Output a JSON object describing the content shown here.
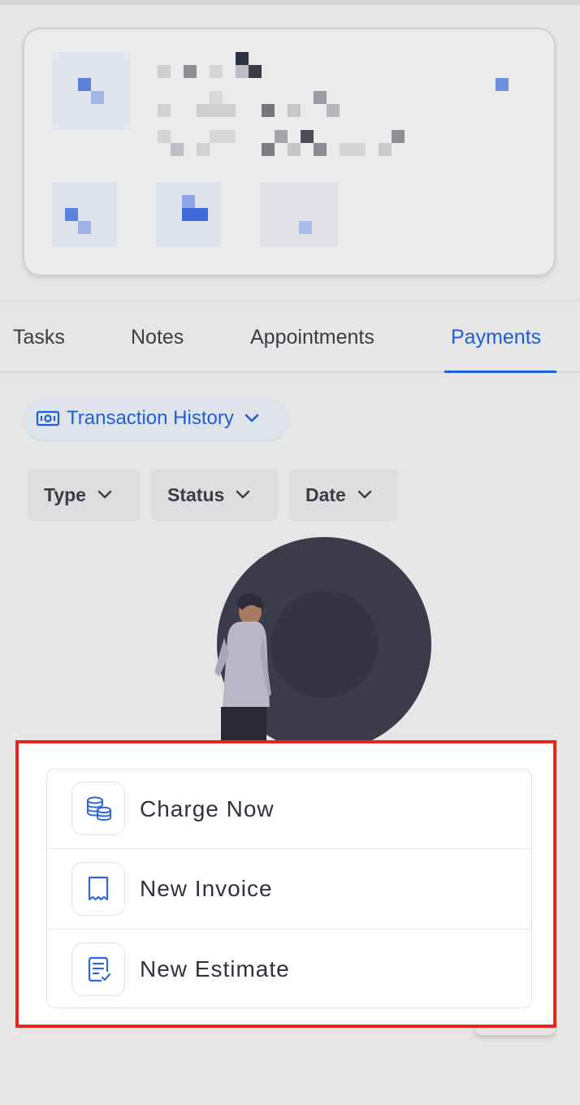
{
  "tabs": [
    {
      "label": "Tasks"
    },
    {
      "label": "Notes"
    },
    {
      "label": "Appointments"
    },
    {
      "label": "Payments",
      "active": true
    }
  ],
  "history_dropdown": {
    "label": "Transaction History"
  },
  "filters": [
    {
      "label": "Type"
    },
    {
      "label": "Status"
    },
    {
      "label": "Date"
    }
  ],
  "actions": [
    {
      "label": "Charge Now",
      "icon": "coins-icon"
    },
    {
      "label": "New Invoice",
      "icon": "receipt-icon"
    },
    {
      "label": "New Estimate",
      "icon": "estimate-checklist-icon"
    }
  ],
  "colors": {
    "accent": "#1f5fd6",
    "highlight_border": "#e8261c",
    "background": "#e6e6e6"
  }
}
